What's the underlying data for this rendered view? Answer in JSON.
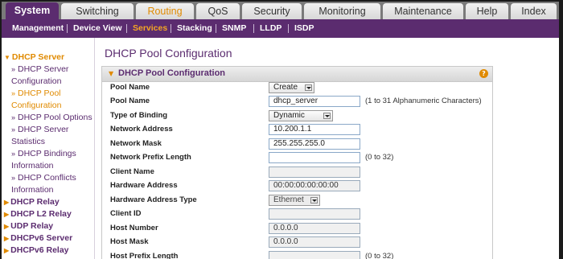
{
  "tabs": [
    "System",
    "Switching",
    "Routing",
    "QoS",
    "Security",
    "Monitoring",
    "Maintenance",
    "Help",
    "Index"
  ],
  "subnav": [
    "Management",
    "Device View",
    "Services",
    "Stacking",
    "SNMP",
    "LLDP",
    "ISDP"
  ],
  "sidebar": {
    "dhcp_server": "DHCP Server",
    "items": [
      [
        "DHCP Server",
        "Configuration"
      ],
      [
        "DHCP Pool",
        "Configuration"
      ],
      [
        "DHCP Pool Options"
      ],
      [
        "DHCP Server",
        "Statistics"
      ],
      [
        "DHCP Bindings",
        "Information"
      ],
      [
        "DHCP Conflicts",
        "Information"
      ]
    ],
    "sections": [
      "DHCP Relay",
      "DHCP L2 Relay",
      "UDP Relay",
      "DHCPv6 Server",
      "DHCPv6 Relay"
    ]
  },
  "page_title": "DHCP Pool Configuration",
  "panel_title": "DHCP Pool Configuration",
  "help_icon": "?",
  "form": {
    "pool_name_select": {
      "label": "Pool Name",
      "value": "Create"
    },
    "pool_name": {
      "label": "Pool Name",
      "value": "dhcp_server",
      "hint": "(1 to 31 Alphanumeric Characters)"
    },
    "binding": {
      "label": "Type of Binding",
      "value": "Dynamic"
    },
    "network_address": {
      "label": "Network Address",
      "value": "10.200.1.1"
    },
    "network_mask": {
      "label": "Network Mask",
      "value": "255.255.255.0"
    },
    "prefix_length": {
      "label": "Network Prefix Length",
      "value": "",
      "hint": "(0 to 32)"
    },
    "client_name": {
      "label": "Client Name",
      "value": ""
    },
    "hw_address": {
      "label": "Hardware Address",
      "value": "00:00:00:00:00:00"
    },
    "hw_type": {
      "label": "Hardware Address Type",
      "value": "Ethernet"
    },
    "client_id": {
      "label": "Client ID",
      "value": ""
    },
    "host_number": {
      "label": "Host Number",
      "value": "0.0.0.0"
    },
    "host_mask": {
      "label": "Host Mask",
      "value": "0.0.0.0"
    },
    "host_prefix": {
      "label": "Host Prefix Length",
      "value": "",
      "hint": "(0 to 32)"
    }
  }
}
